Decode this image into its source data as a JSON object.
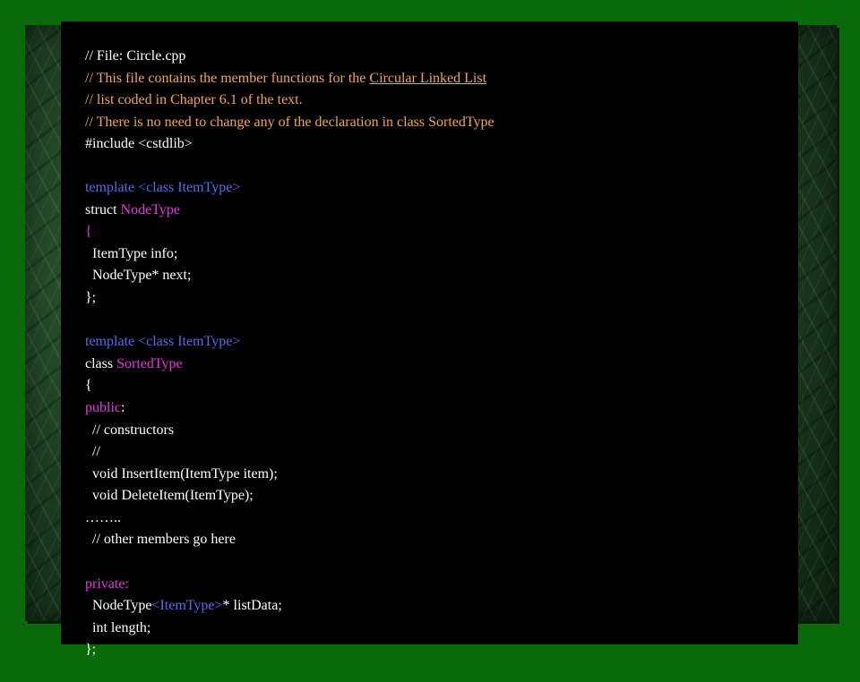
{
  "slide": {
    "colors": {
      "background": "#0a6a0a",
      "panel": "#000000",
      "text": "#ffffff",
      "comment": "#f3a552",
      "keyword": "#5a6af0",
      "type_name": "#e23ae0"
    },
    "code": {
      "l1": "// File: Circle.cpp",
      "l2a": "// This file contains the member functions for the ",
      "l2b": "Circular Linked List",
      "l3": "// list coded in Chapter 6.1 of the text.",
      "l4": "// There is no need to change any of the declaration in class SortedType",
      "l5": "#include <cstdlib>",
      "l7": "template <class ItemType>",
      "l8a": "struct ",
      "l8b": "NodeType",
      "l9": "{",
      "l10": "  ItemType info;",
      "l11": "  NodeType* next;",
      "l12": "};",
      "l14": "template <class ItemType>",
      "l15a": "class ",
      "l15b": "SortedType",
      "l16": "{",
      "l17a": "public",
      "l17b": ":",
      "l18": "  // constructors",
      "l19": "  //",
      "l20": "  void InsertItem(ItemType item);",
      "l21": "  void DeleteItem(ItemType);",
      "l22": "……..",
      "l23": "  // other members go here",
      "l25": "private:",
      "l26a": "  NodeType",
      "l26b": "<ItemType>",
      "l26c": "* listData;",
      "l27": "  int length;",
      "l28": "};"
    }
  }
}
